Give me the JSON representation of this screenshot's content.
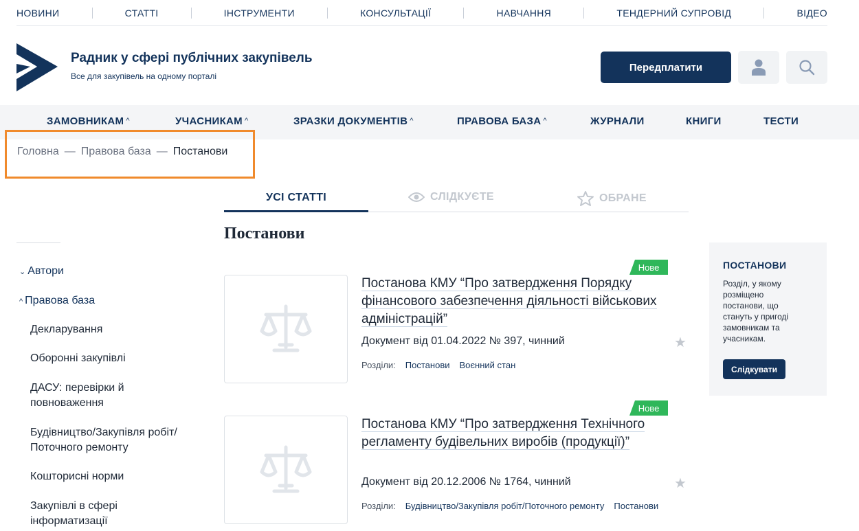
{
  "topnav": [
    "НОВИНИ",
    "СТАТТІ",
    "ІНСТРУМЕНТИ",
    "КОНСУЛЬТАЦІЇ",
    "НАВЧАННЯ",
    "ТЕНДЕРНИЙ СУПРОВІД",
    "ВІДЕО"
  ],
  "header": {
    "title": "Радник у сфері публічних закупівель",
    "subtitle": "Все для закупівель на одному порталі",
    "subscribe_label": "Передплатити",
    "icons": [
      "user-icon",
      "search-icon"
    ]
  },
  "mainnav": [
    {
      "label": "ЗАМОВНИКАМ",
      "caret": "^"
    },
    {
      "label": "УЧАСНИКАМ",
      "caret": "^"
    },
    {
      "label": "ЗРАЗКИ ДОКУМЕНТІВ",
      "caret": "^"
    },
    {
      "label": "ПРАВОВА БАЗА",
      "caret": "^"
    },
    {
      "label": "ЖУРНАЛИ",
      "caret": ""
    },
    {
      "label": "КНИГИ",
      "caret": ""
    },
    {
      "label": "ТЕСТИ",
      "caret": ""
    }
  ],
  "breadcrumb": {
    "home": "Головна",
    "section": "Правова база",
    "current": "Постанови",
    "separator": "—"
  },
  "tabs": {
    "all": "УСІ СТАТТІ",
    "following": "СЛІДКУЄТЕ",
    "favorites": "ОБРАНЕ"
  },
  "page_title": "Постанови",
  "sidebar": {
    "groups": [
      {
        "label": "Автори",
        "chevron": "⌄"
      },
      {
        "label": "Правова база",
        "chevron": "^"
      }
    ],
    "items": [
      "Декларування",
      "Оборонні закупівлі",
      "ДАСУ: перевірки й повноваження",
      "Будівництво/Закупівля робіт/ Поточного ремонту",
      "Кошторисні норми",
      "Закупівлі в сфері інформатизації"
    ]
  },
  "articles": [
    {
      "badge": "Нове",
      "title": "Постанова КМУ “Про затвердження Порядку фінансового забезпечення діяльності військових адміністрацій”",
      "meta": "Документ від 01.04.2022 № 397, чинний",
      "sections_label": "Розділи:",
      "tags": [
        "Постанови",
        "Воєнний стан"
      ]
    },
    {
      "badge": "Нове",
      "title": "Постанова КМУ “Про затвердження Технічного регламенту будівельних виробів (продукції)”",
      "meta": "Документ від 20.12.2006 № 1764, чинний",
      "sections_label": "Розділи:",
      "tags": [
        "Будівництво/Закупівля робіт/Поточного ремонту",
        "Постанови"
      ]
    }
  ],
  "panel": {
    "title": "ПОСТАНОВИ",
    "description": "Розділ, у якому розміщено постанови, що стануть у пригоді замовникам та учасникам.",
    "follow_label": "Слідкувати"
  },
  "colors": {
    "brand": "#13335b",
    "badge": "#2fb75a",
    "highlight": "#f08a2c"
  }
}
